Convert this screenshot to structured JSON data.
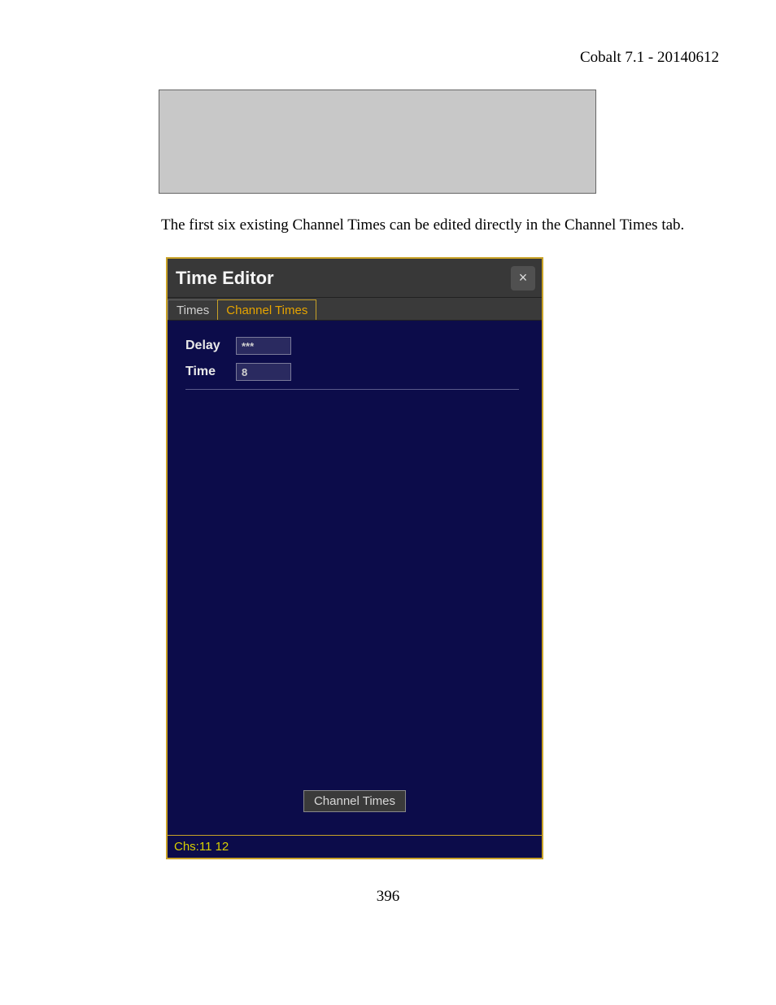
{
  "doc": {
    "header": "Cobalt 7.1 - 20140612",
    "caption": "The first six existing Channel Times can be edited directly in the Channel Times tab.",
    "page_number": "396"
  },
  "window": {
    "title": "Time Editor",
    "close_glyph": "×",
    "tabs": [
      {
        "label": "Times",
        "active": false
      },
      {
        "label": "Channel Times",
        "active": true
      }
    ],
    "fields": {
      "delay": {
        "label": "Delay",
        "value": "***"
      },
      "time": {
        "label": "Time",
        "value": "8"
      }
    },
    "bottom_tab": "Channel Times",
    "status": "Chs:11 12"
  }
}
